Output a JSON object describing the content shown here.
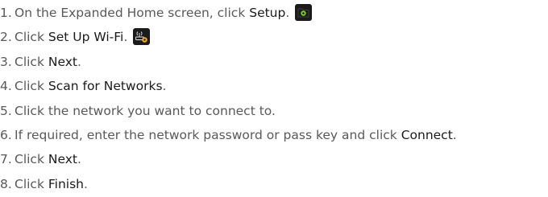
{
  "steps": [
    {
      "num": "1.",
      "pre": "On the Expanded Home screen, click ",
      "bold": "Setup",
      "post": ".",
      "icon": "setup-icon"
    },
    {
      "num": "2.",
      "pre": "Click ",
      "bold": "Set Up Wi-Fi",
      "post": ".",
      "icon": "wifi-router-gear-icon"
    },
    {
      "num": "3.",
      "pre": "Click ",
      "bold": "Next",
      "post": "."
    },
    {
      "num": "4.",
      "pre": "Click ",
      "bold": "Scan for Networks",
      "post": "."
    },
    {
      "num": "5.",
      "pre": "Click the network you want to connect to.",
      "bold": "",
      "post": ""
    },
    {
      "num": "6.",
      "pre": "If required, enter the network password or pass key and click ",
      "bold": "Connect",
      "post": "."
    },
    {
      "num": "7.",
      "pre": "Click ",
      "bold": "Next",
      "post": "."
    },
    {
      "num": "8.",
      "pre": "Click ",
      "bold": "Finish",
      "post": "."
    }
  ],
  "colors": {
    "text": "#595959",
    "emphasis": "#1a1a1a",
    "icon_bg": "#1b1b1b",
    "setup_icon_accent": "#7bd321",
    "wifi_icon_accent": "#f5a623"
  }
}
